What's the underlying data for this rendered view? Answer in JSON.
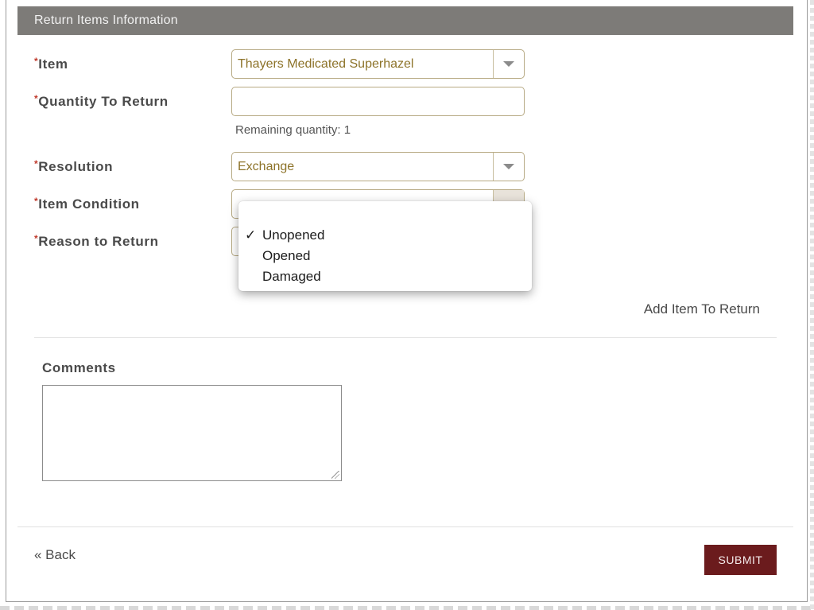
{
  "section": {
    "title": "Return Items Information"
  },
  "form": {
    "item": {
      "label": "Item",
      "value": "Thayers Medicated Superhazel"
    },
    "quantity": {
      "label": "Quantity To Return",
      "value": "",
      "remaining": "Remaining quantity: 1"
    },
    "resolution": {
      "label": "Resolution",
      "value": "Exchange"
    },
    "condition": {
      "label": "Item Condition",
      "options": [
        "Unopened",
        "Opened",
        "Damaged"
      ],
      "selected_check": "✓"
    },
    "reason": {
      "label": "Reason to Return"
    },
    "required_marker": "*",
    "add_item_link": "Add Item To Return"
  },
  "comments": {
    "label": "Comments",
    "value": ""
  },
  "footer": {
    "back_label": "« Back",
    "submit_label": "SUBMIT"
  },
  "colors": {
    "header_bg": "#7d7b78",
    "submit_bg": "#6b1b1d",
    "select_text": "#8d7329",
    "required": "#c0392b"
  }
}
